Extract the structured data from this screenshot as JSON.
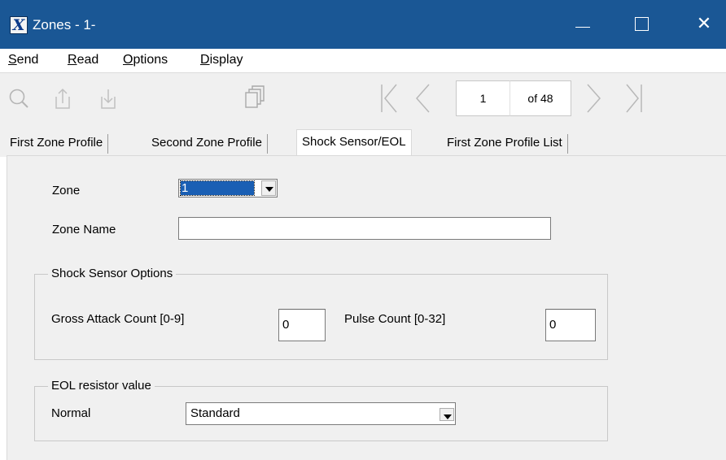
{
  "window": {
    "title": "Zones - 1-",
    "app_icon_letter": "X",
    "controls": {
      "minimize": "—",
      "maximize": "☐",
      "close": "✕"
    }
  },
  "menu": [
    {
      "label": "Send",
      "accel": "S",
      "rest": "end"
    },
    {
      "label": "Read",
      "accel": "R",
      "rest": "ead"
    },
    {
      "label": "Options",
      "accel": "O",
      "rest": "ptions"
    },
    {
      "label": "Display",
      "accel": "D",
      "rest": "isplay"
    }
  ],
  "toolbar": {
    "icons": [
      "search-icon",
      "upload-icon",
      "download-icon",
      "copy-icon",
      "first-page-icon",
      "previous-page-icon",
      "next-page-icon",
      "last-page-icon"
    ],
    "current_page": "1",
    "page_total_label": "of 48"
  },
  "tabs": [
    {
      "label": "First Zone Profile",
      "active": false
    },
    {
      "label": "Second Zone Profile",
      "active": false
    },
    {
      "label": "Shock Sensor/EOL",
      "active": true
    },
    {
      "label": "First Zone Profile List",
      "active": false
    }
  ],
  "form": {
    "zone_label": "Zone",
    "zone_value": "1",
    "zone_name_label": "Zone Name",
    "zone_name_value": "",
    "shock_group_title": "Shock Sensor Options",
    "gross_attack_label": "Gross Attack Count [0-9]",
    "gross_attack_value": "0",
    "pulse_count_label": "Pulse Count [0-32]",
    "pulse_count_value": "0",
    "eol_group_title": "EOL resistor value",
    "normal_label": "Normal",
    "normal_value": "Standard"
  },
  "colors": {
    "titlebar": "#1a5795",
    "selection": "#1a5fb4",
    "face": "#f0f0f0"
  }
}
